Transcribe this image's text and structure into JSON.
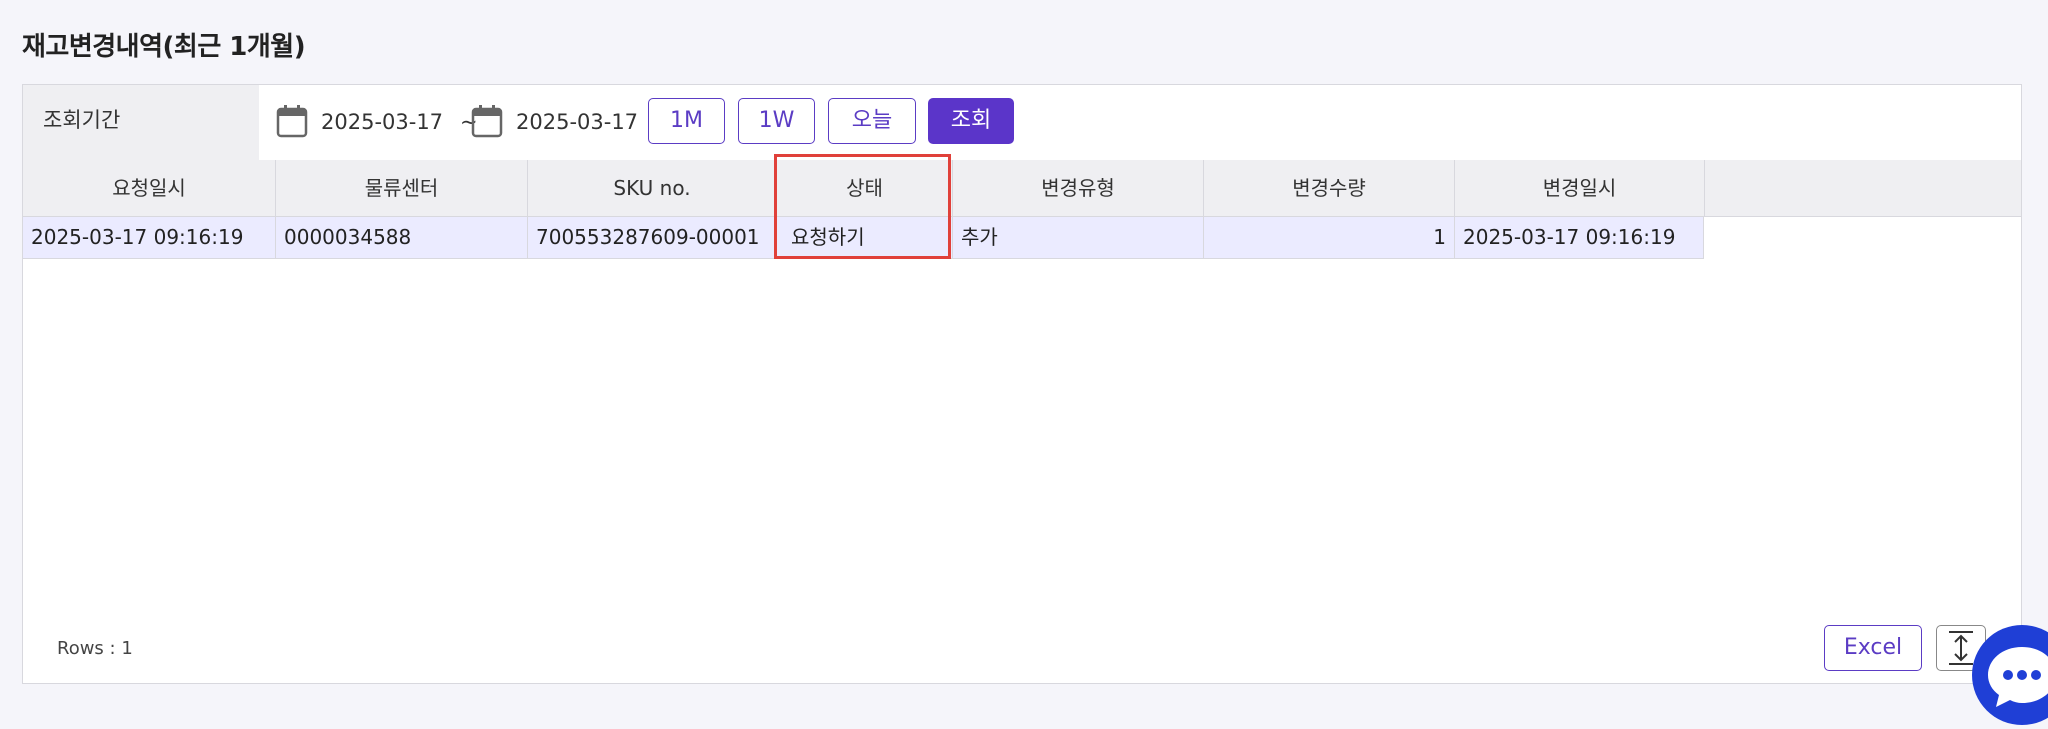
{
  "page": {
    "title": "재고변경내역(최근 1개월)"
  },
  "filter": {
    "label": "조회기간",
    "start_date": "2025-03-17",
    "separator": "~",
    "end_date": "2025-03-17",
    "buttons": {
      "one_month": "1M",
      "one_week": "1W",
      "today": "오늘",
      "search": "조회"
    }
  },
  "grid": {
    "columns": [
      "요청일시",
      "물류센터",
      "SKU no.",
      "상태",
      "변경유형",
      "변경수량",
      "변경일시"
    ],
    "rows": [
      [
        "2025-03-17 09:16:19",
        "0000034588",
        "700553287609-00001",
        "요청하기",
        "추가",
        "1",
        "2025-03-17 09:16:19"
      ]
    ]
  },
  "footer": {
    "rows_label": "Rows : 1",
    "excel_label": "Excel"
  },
  "colors": {
    "accent": "#5b35c9",
    "highlight": "#e0403a",
    "row_selected": "#ebebff",
    "chat": "#1f3fd6"
  },
  "icons": [
    "calendar-icon",
    "resize-icon",
    "chat-icon"
  ]
}
